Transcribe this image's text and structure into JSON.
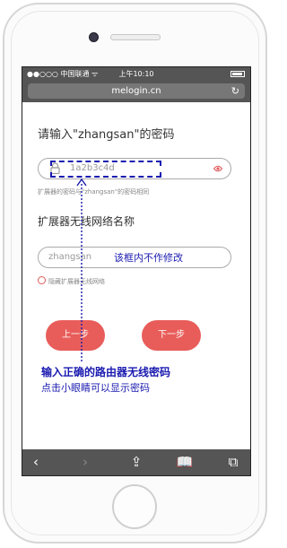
{
  "status_bar": {
    "carrier": "●●○○○ 中国联通 ᯤ",
    "time": "上午10:10"
  },
  "browser": {
    "url": "melogin.cn"
  },
  "form": {
    "password_title": "请输入\"zhangsan\"的密码",
    "password_value": "1a2b3c4d",
    "password_hint": "扩展器的密码与\"zhangsan\"的密码相同",
    "ssid_title": "扩展器无线网络名称",
    "ssid_value": "zhangsan",
    "ssid_note": "该框内不作修改",
    "hide_ssid_label": "隐藏扩展器无线网络",
    "prev_button": "上一步",
    "next_button": "下一步"
  },
  "annotation": {
    "line1": "输入正确的路由器无线密码",
    "line2": "点击小眼睛可以显示密码"
  },
  "toolbar": {
    "back": "‹",
    "forward": "›",
    "share": "⇪",
    "bookmarks": "📖",
    "tabs": "⧉"
  },
  "colors": {
    "accent": "#e85d5a",
    "annotation": "#1a1ab0",
    "browser_chrome": "#555555"
  }
}
